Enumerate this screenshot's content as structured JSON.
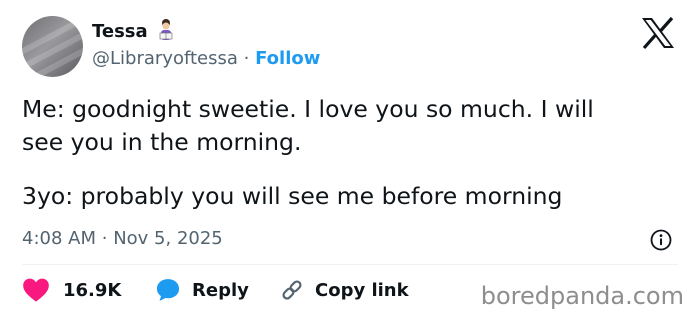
{
  "author": {
    "name": "Tessa",
    "handle": "@Libraryoftessa",
    "separator": "·",
    "follow_label": "Follow"
  },
  "post": {
    "line1": "Me: goodnight sweetie. I love you so much. I will",
    "line2": "see you in the morning.",
    "line3": "3yo: probably you will see me before morning"
  },
  "meta": {
    "time": "4:08 AM",
    "separator": "·",
    "date": "Nov 5, 2025"
  },
  "actions": {
    "likes": "16.9K",
    "reply_label": "Reply",
    "copy_label": "Copy link"
  },
  "watermark": "boredpanda.com",
  "icons": {
    "name_emoji": "woman-with-book-icon",
    "platform": "x-logo-icon",
    "info": "info-icon",
    "like": "heart-icon",
    "reply": "speech-bubble-icon",
    "copy": "link-icon"
  },
  "colors": {
    "text": "#0f1419",
    "secondary": "#536471",
    "accent": "#1d9bf0",
    "like": "#f91880",
    "divider": "#eff3f4",
    "watermark": "#8e8e8e"
  }
}
